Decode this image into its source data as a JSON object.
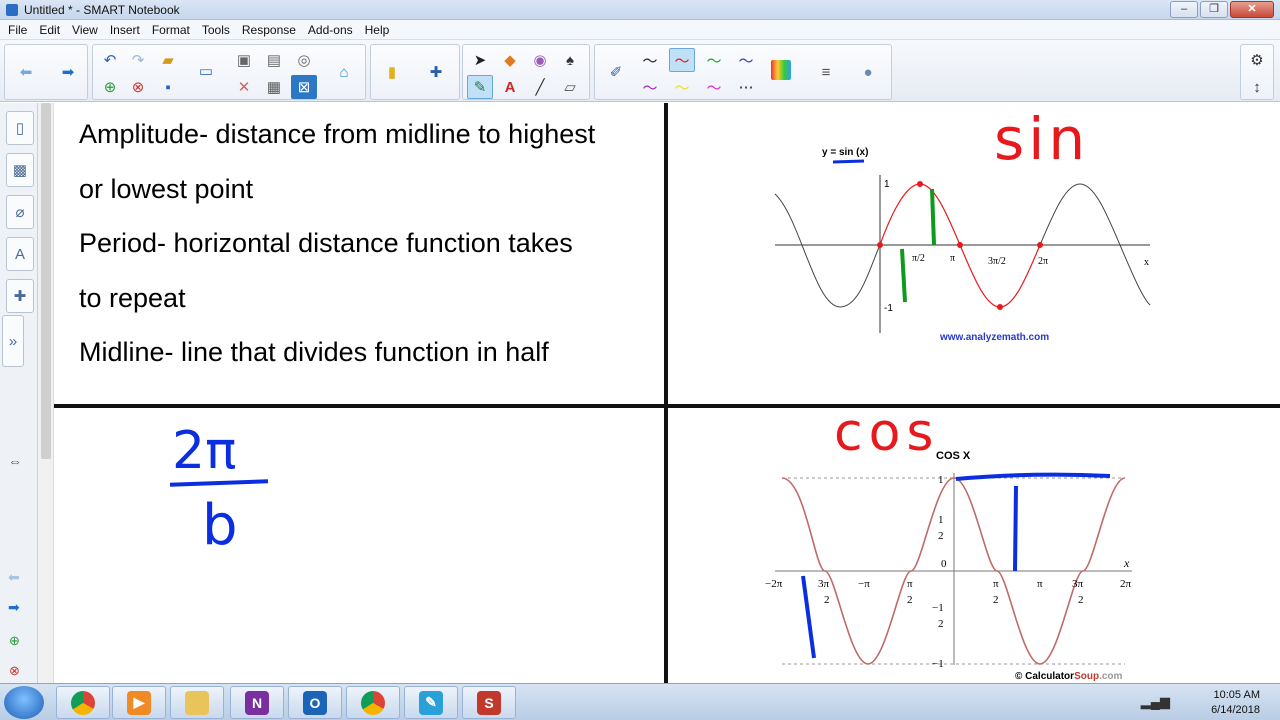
{
  "window": {
    "title": "Untitled * - SMART Notebook",
    "min": "–",
    "max": "❐",
    "close": "✕"
  },
  "menu": [
    "File",
    "Edit",
    "View",
    "Insert",
    "Format",
    "Tools",
    "Response",
    "Add-ons",
    "Help"
  ],
  "notes": {
    "line1": "Amplitude- distance from midline to highest",
    "line2": "or lowest point",
    "line3": "Period- horizontal distance function takes",
    "line4": "to repeat",
    "line5": "Midline- line that divides function in half"
  },
  "handwriting": {
    "sin": "sin",
    "cos": "cos",
    "numerator": "2π",
    "denominator": "b"
  },
  "sin_graph": {
    "label": "y = sin (x)",
    "y_ticks": [
      "1",
      "-1"
    ],
    "x_ticks": [
      "π/2",
      "π",
      "3π/2",
      "2π"
    ],
    "x_axis": "x",
    "credit": "www.analyzemath.com"
  },
  "cos_graph": {
    "title": "COS X",
    "x_axis": "x",
    "y_ticks": [
      "1",
      "1",
      "2",
      "0",
      "−1",
      "2",
      "−1"
    ],
    "x_ticks": [
      "−2π",
      "3π",
      "2",
      "−π",
      "π",
      "2",
      "π",
      "2",
      "π",
      "3π",
      "2",
      "2π"
    ],
    "credit_prefix": "© Calculator",
    "credit_brand": "Soup",
    "credit_suffix": ".com"
  },
  "taskbar": {
    "time": "10:05 AM",
    "date": "6/14/2018"
  },
  "colors": {
    "ink_red": "#e8191c",
    "ink_blue": "#0b2ee0",
    "ink_green": "#0f9a1c",
    "curve": "#c06a6a"
  }
}
